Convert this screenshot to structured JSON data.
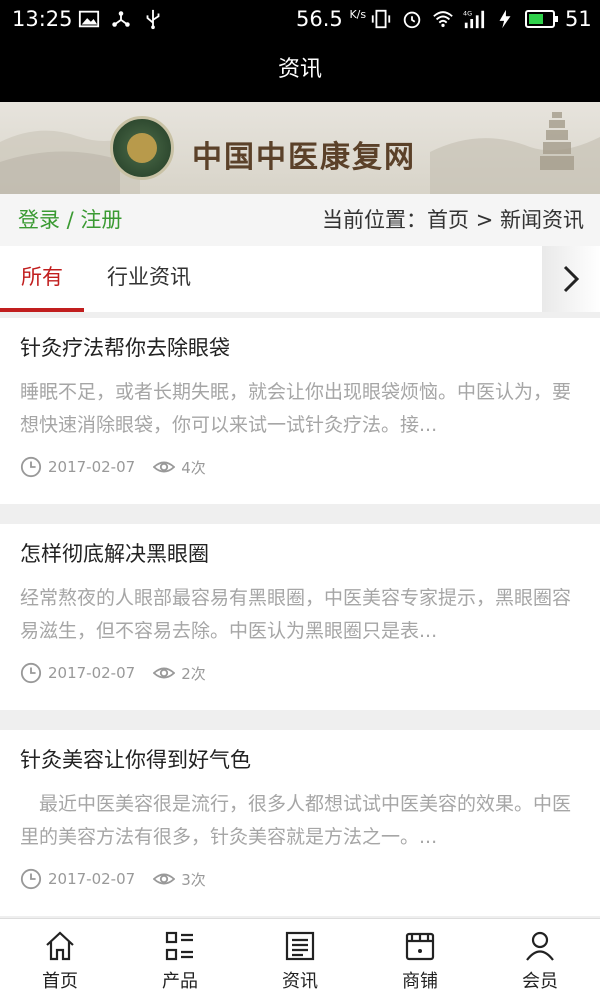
{
  "status_bar": {
    "time": "13:25",
    "speed": "56.5",
    "speed_unit": "K/s",
    "network": "4G",
    "battery": "51"
  },
  "header": {
    "title": "资讯"
  },
  "banner": {
    "site_name": "中国中医康复网",
    "seal_text": "BEST OF GOOD HEALTH"
  },
  "breadcrumb": {
    "login": "登录 / 注册",
    "current": "当前位置：首页 > 新闻资讯"
  },
  "tabs": [
    {
      "label": "所有",
      "active": true
    },
    {
      "label": "行业资讯",
      "active": false
    }
  ],
  "articles": [
    {
      "title": "针灸疗法帮你去除眼袋",
      "summary": "睡眠不足，或者长期失眠，就会让你出现眼袋烦恼。中医认为，要想快速消除眼袋，你可以来试一试针灸疗法。接...",
      "date": "2017-02-07",
      "views": "4次"
    },
    {
      "title": "怎样彻底解决黑眼圈",
      "summary": "经常熬夜的人眼部最容易有黑眼圈，中医美容专家提示，黑眼圈容易滋生，但不容易去除。中医认为黑眼圈只是表...",
      "date": "2017-02-07",
      "views": "2次"
    },
    {
      "title": "针灸美容让你得到好气色",
      "summary": "　最近中医美容很是流行，很多人都想试试中医美容的效果。中医里的美容方法有很多，针灸美容就是方法之一。...",
      "date": "2017-02-07",
      "views": "3次"
    }
  ],
  "bottom_nav": [
    {
      "label": "首页",
      "icon": "home-icon"
    },
    {
      "label": "产品",
      "icon": "product-grid-icon"
    },
    {
      "label": "资讯",
      "icon": "news-icon"
    },
    {
      "label": "商铺",
      "icon": "shop-icon"
    },
    {
      "label": "会员",
      "icon": "member-icon"
    }
  ],
  "colors": {
    "accent_red": "#c11e1e",
    "login_green": "#3a9a32"
  }
}
